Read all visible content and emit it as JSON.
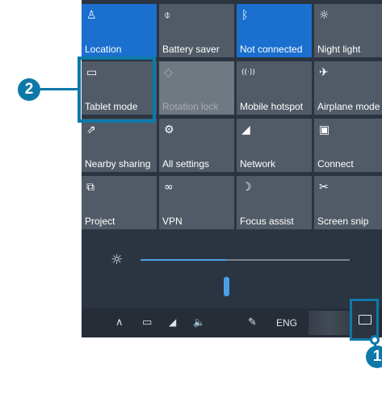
{
  "quick_actions": [
    {
      "label": "Location",
      "icon": "location-icon",
      "glyph": "♙",
      "state": "on"
    },
    {
      "label": "Battery saver",
      "icon": "battery-saver-icon",
      "glyph": "⌽",
      "state": "off"
    },
    {
      "label": "Not connected",
      "icon": "bluetooth-icon",
      "glyph": "ᛒ",
      "state": "on"
    },
    {
      "label": "Night light",
      "icon": "night-light-icon",
      "glyph": "☼",
      "state": "off"
    },
    {
      "label": "Tablet mode",
      "icon": "tablet-mode-icon",
      "glyph": "▭",
      "state": "off"
    },
    {
      "label": "Rotation lock",
      "icon": "rotation-lock-icon",
      "glyph": "◇",
      "state": "disabled"
    },
    {
      "label": "Mobile hotspot",
      "icon": "mobile-hotspot-icon",
      "glyph": "((·))",
      "state": "off"
    },
    {
      "label": "Airplane mode",
      "icon": "airplane-icon",
      "glyph": "✈",
      "state": "off"
    },
    {
      "label": "Nearby sharing",
      "icon": "nearby-sharing-icon",
      "glyph": "⇗",
      "state": "off"
    },
    {
      "label": "All settings",
      "icon": "gear-icon",
      "glyph": "⚙",
      "state": "off"
    },
    {
      "label": "Network",
      "icon": "network-icon",
      "glyph": "◢",
      "state": "off"
    },
    {
      "label": "Connect",
      "icon": "connect-icon",
      "glyph": "▣",
      "state": "off"
    },
    {
      "label": "Project",
      "icon": "project-icon",
      "glyph": "⧉",
      "state": "off"
    },
    {
      "label": "VPN",
      "icon": "vpn-icon",
      "glyph": "∞",
      "state": "off"
    },
    {
      "label": "Focus assist",
      "icon": "moon-icon",
      "glyph": "☽",
      "state": "off"
    },
    {
      "label": "Screen snip",
      "icon": "scissors-icon",
      "glyph": "✂",
      "state": "off"
    }
  ],
  "brightness": {
    "level_fraction": 0.41,
    "icon": "brightness-icon",
    "glyph": "☼"
  },
  "taskbar": {
    "chevron": {
      "icon": "chevron-up-icon",
      "glyph": "∧"
    },
    "battery": {
      "icon": "battery-icon",
      "glyph": "▭"
    },
    "network": {
      "icon": "wifi-icon",
      "glyph": "◢"
    },
    "volume": {
      "icon": "volume-icon",
      "glyph": "🔈"
    },
    "pen": {
      "icon": "pen-icon",
      "glyph": "✎"
    },
    "language": "ENG",
    "action_center": {
      "icon": "action-center-icon"
    }
  },
  "callouts": [
    "1",
    "2"
  ],
  "colors": {
    "accent": "#1a6fcf",
    "tile": "#515b67",
    "panel": "#2b3441",
    "callout": "#0e79a9"
  }
}
